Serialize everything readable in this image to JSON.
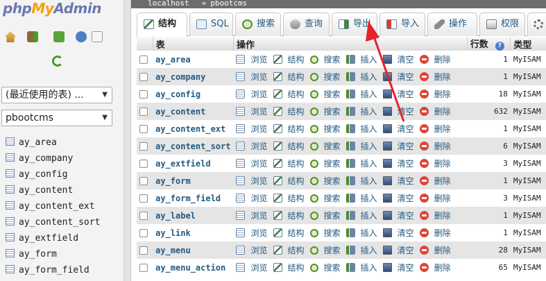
{
  "app": {
    "logo_php": "php",
    "logo_my": "My",
    "logo_admin": "Admin"
  },
  "nav": {
    "recent_select": "(最近使用的表) ...",
    "db_select": "pbootcms",
    "tables": [
      "ay_area",
      "ay_company",
      "ay_config",
      "ay_content",
      "ay_content_ext",
      "ay_content_sort",
      "ay_extfield",
      "ay_form",
      "ay_form_field"
    ]
  },
  "breadcrumb": {
    "server": "localhost",
    "separator": "»",
    "database": "pbootcms"
  },
  "tabs": [
    {
      "label": "结构",
      "icon": "structure-icon"
    },
    {
      "label": "SQL",
      "icon": "sql-icon"
    },
    {
      "label": "搜索",
      "icon": "search-icon"
    },
    {
      "label": "查询",
      "icon": "query-icon"
    },
    {
      "label": "导出",
      "icon": "export-icon"
    },
    {
      "label": "导入",
      "icon": "import-icon"
    },
    {
      "label": "操作",
      "icon": "wrench-icon"
    },
    {
      "label": "权限",
      "icon": "privileges-icon"
    }
  ],
  "grid": {
    "headers": {
      "table": "表",
      "action": "操作",
      "rows": "行数",
      "type": "类型"
    },
    "actions": {
      "browse": "浏览",
      "structure": "结构",
      "search": "搜索",
      "insert": "插入",
      "empty": "清空",
      "drop": "删除"
    },
    "rows": [
      {
        "name": "ay_area",
        "rows": "1",
        "engine": "MyISAM"
      },
      {
        "name": "ay_company",
        "rows": "1",
        "engine": "MyISAM"
      },
      {
        "name": "ay_config",
        "rows": "18",
        "engine": "MyISAM"
      },
      {
        "name": "ay_content",
        "rows": "632",
        "engine": "MyISAM"
      },
      {
        "name": "ay_content_ext",
        "rows": "1",
        "engine": "MyISAM"
      },
      {
        "name": "ay_content_sort",
        "rows": "6",
        "engine": "MyISAM"
      },
      {
        "name": "ay_extfield",
        "rows": "3",
        "engine": "MyISAM"
      },
      {
        "name": "ay_form",
        "rows": "1",
        "engine": "MyISAM"
      },
      {
        "name": "ay_form_field",
        "rows": "3",
        "engine": "MyISAM"
      },
      {
        "name": "ay_label",
        "rows": "1",
        "engine": "MyISAM"
      },
      {
        "name": "ay_link",
        "rows": "1",
        "engine": "MyISAM"
      },
      {
        "name": "ay_menu",
        "rows": "28",
        "engine": "MyISAM"
      },
      {
        "name": "ay_menu_action",
        "rows": "65",
        "engine": "MyISAM"
      }
    ]
  },
  "annotation_color": "#e8202a"
}
